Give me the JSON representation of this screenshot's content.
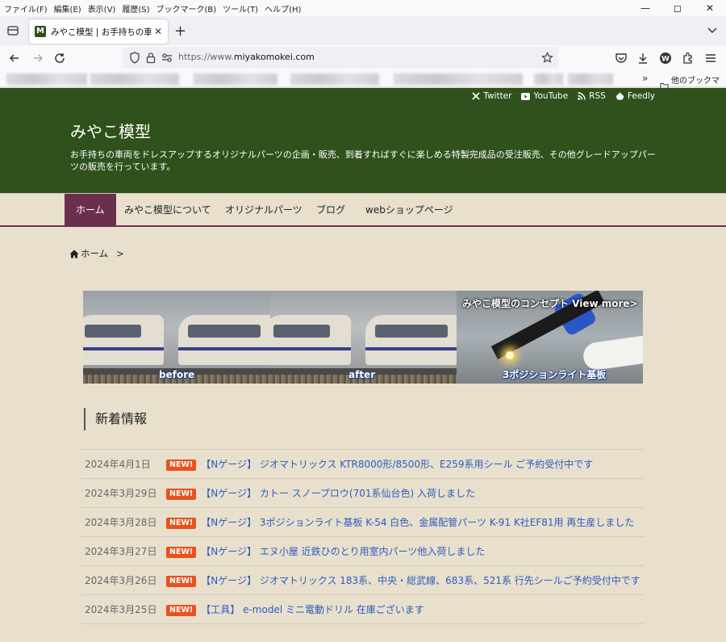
{
  "browser": {
    "menu": [
      "ファイル(F)",
      "編集(E)",
      "表示(V)",
      "履歴(S)",
      "ブックマーク(B)",
      "ツール(T)",
      "ヘルプ(H)"
    ],
    "tab_title": "みやこ模型 | お手持ちの車両をドレ",
    "tab_favicon": "M",
    "url_prefix": "https://www.",
    "url_domain": "miyakomokei.com",
    "bookmark_folder": "他のブックマーク",
    "overflow_glyph": "»"
  },
  "header": {
    "social": [
      "Twitter",
      "YouTube",
      "RSS",
      "Feedly"
    ],
    "site_title": "みやこ模型",
    "site_description": "お手持ちの車両をドレスアップするオリジナルパーツの企画・販売、到着すればすぐに楽しめる特製完成品の受注販売、その他グレードアップパーツの販売を行っています。",
    "colors": {
      "header_bg": "#2f511b",
      "nav_active": "#6b2f4e",
      "page_bg": "#e8e0cd",
      "link": "#2d5bbf",
      "new_badge": "#e8521d"
    }
  },
  "nav": [
    "ホーム",
    "みやこ模型について",
    "オリジナルパーツ",
    "ブログ",
    "webショップページ"
  ],
  "breadcrumb": {
    "label": "ホーム",
    "separator": ">"
  },
  "banner": {
    "before": "before",
    "after": "after",
    "concept": "みやこ模型のコンセプト View more>",
    "board": "3ポジションライト基板"
  },
  "news": {
    "heading": "新着情報",
    "badge": "NEW!",
    "items": [
      {
        "date": "2024年4月1日",
        "text": "【Nゲージ】 ジオマトリックス KTR8000形/8500形、E259系用シール ご予約受付中です"
      },
      {
        "date": "2024年3月29日",
        "text": "【Nゲージ】 カトー スノープロウ(701系仙台色) 入荷しました"
      },
      {
        "date": "2024年3月28日",
        "text": "【Nゲージ】 3ポジションライト基板 K-54 白色、金属配管パーツ K-91 K社EF81用 再生産しました"
      },
      {
        "date": "2024年3月27日",
        "text": "【Nゲージ】 エヌ小屋 近鉄ひのとり用室内パーツ他入荷しました"
      },
      {
        "date": "2024年3月26日",
        "text": "【Nゲージ】 ジオマトリックス 183系、中央・総武線、683系、521系 行先シールご予約受付中です"
      },
      {
        "date": "2024年3月25日",
        "text": "【工具】 e-model ミニ電動ドリル 在庫ございます"
      }
    ]
  }
}
